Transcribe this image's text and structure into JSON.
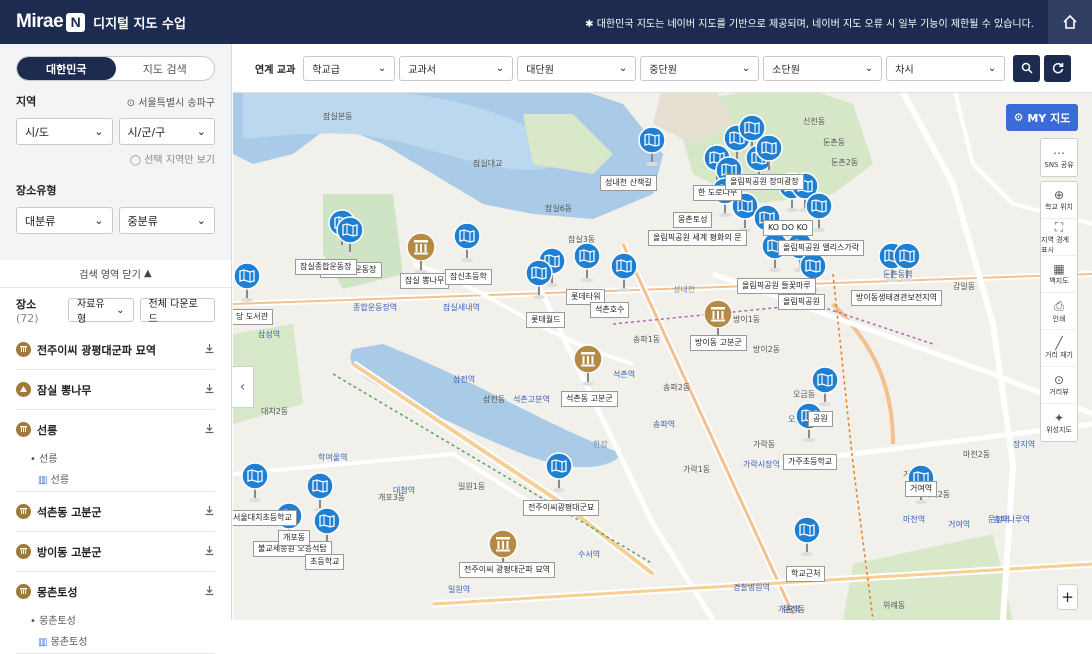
{
  "header": {
    "logo": "Mirae",
    "logo_n": "N",
    "app_title": "디지털 지도 수업",
    "notice": "✱ 대한민국 지도는 네이버 지도를 기반으로 제공되며, 네이버 지도 오류 시 일부 기능이 제한될 수 있습니다."
  },
  "sidebar": {
    "tabs": [
      "대한민국",
      "지도 검색"
    ],
    "region_label": "지역",
    "location": "서울특별시 송파구",
    "sido": "시/도",
    "sigungu": "시/군/구",
    "only_selected": "선택 지역만 보기",
    "place_type_label": "장소유형",
    "major": "대분류",
    "middle": "중분류",
    "collapse": "검색 영역 닫기",
    "list_title": "장소",
    "list_count": "(72)",
    "filter_btn": "자료유형",
    "download_all": "전체 다운로드",
    "items": [
      {
        "name": "전주이씨 광평대군파 묘역",
        "icon": "building"
      },
      {
        "name": "잠실 뽕나무",
        "icon": "tree"
      },
      {
        "name": "선릉",
        "icon": "building",
        "subs": [
          "선릉"
        ],
        "subsubs": [
          "선릉"
        ]
      },
      {
        "name": "석촌동 고분군",
        "icon": "building"
      },
      {
        "name": "방이동 고분군",
        "icon": "building"
      },
      {
        "name": "몽촌토성",
        "icon": "building",
        "subs": [
          "몽촌토성"
        ],
        "subsubs": [
          "몽촌토성"
        ]
      }
    ]
  },
  "toolbar": {
    "label": "연계 교과",
    "selects": [
      "학교급",
      "교과서",
      "대단원",
      "중단원",
      "소단원",
      "차시"
    ]
  },
  "map": {
    "mymap": "MY 지도",
    "tools": [
      [
        "SNS 공유",
        "share-icon"
      ],
      [
        "학교 위치",
        "target-icon"
      ],
      [
        "지역 경계 표시",
        "border-icon"
      ],
      [
        "백지도",
        "blankmap-icon"
      ],
      [
        "인쇄",
        "print-icon"
      ],
      [
        "거리 재기",
        "ruler-icon"
      ],
      [
        "거리뷰",
        "streetview-icon"
      ],
      [
        "위성지도",
        "satellite-icon"
      ]
    ],
    "zoom_in": "+",
    "pin_labels": [
      {
        "text": "성내천 산책길"
      },
      {
        "text": "잠실종합운동장"
      },
      {
        "text": "잠실 뽕나무"
      },
      {
        "text": "잠신초등학"
      },
      {
        "text": "롯데타워"
      },
      {
        "text": "석촌호수"
      },
      {
        "text": "롯데월드"
      },
      {
        "text": "방이동 고분군"
      },
      {
        "text": "석촌동 고분군"
      },
      {
        "text": "올림픽공원 들꽃마루"
      },
      {
        "text": "올림픽공원"
      },
      {
        "text": "방이동생태경관보전지역"
      },
      {
        "text": "가주초등학교"
      },
      {
        "text": "거여역"
      },
      {
        "text": "전주이씨광평대군묘"
      },
      {
        "text": "전주이씨 광평대군파 묘역"
      },
      {
        "text": "불교세종원 오층석탑"
      },
      {
        "text": "학교근처"
      },
      {
        "text": "당 도서관"
      },
      {
        "text": "올림픽공원 세계 평화의 문"
      },
      {
        "text": "잠실종합운동장"
      },
      {
        "text": "몽촌토성"
      },
      {
        "text": "초등학교"
      },
      {
        "text": "개포동"
      },
      {
        "text": "서울대치초등학교"
      },
      {
        "text": "한 도로나무"
      },
      {
        "text": "올림픽공원 장미광장"
      },
      {
        "text": "KO DO KO"
      },
      {
        "text": "올림픽공원 엘리스가락"
      },
      {
        "text": "공원"
      }
    ],
    "labels": [
      {
        "t": "잠실대교"
      },
      {
        "t": "잠실6동"
      },
      {
        "t": "잠실3동"
      },
      {
        "t": "잠실새내역"
      },
      {
        "t": "종합운동장역"
      },
      {
        "t": "삼성역"
      },
      {
        "t": "삼전역"
      },
      {
        "t": "삼전동"
      },
      {
        "t": "석촌역"
      },
      {
        "t": "석촌고분역"
      },
      {
        "t": "송파1동"
      },
      {
        "t": "송파2동"
      },
      {
        "t": "송파역"
      },
      {
        "t": "방이1동"
      },
      {
        "t": "방이2동"
      },
      {
        "t": "가락1동"
      },
      {
        "t": "가락동"
      },
      {
        "t": "문정동"
      },
      {
        "t": "마천2동"
      },
      {
        "t": "거여1동"
      },
      {
        "t": "거여2동"
      },
      {
        "t": "오금역"
      },
      {
        "t": "오금동"
      },
      {
        "t": "둔촌동"
      },
      {
        "t": "둔촌2동"
      },
      {
        "t": "둔촌동역"
      },
      {
        "t": "감일동"
      },
      {
        "t": "일원1동"
      },
      {
        "t": "대치2동"
      },
      {
        "t": "개포3동"
      },
      {
        "t": "대청역"
      },
      {
        "t": "학여울역"
      },
      {
        "t": "수서역"
      },
      {
        "t": "일원역"
      },
      {
        "t": "위례동"
      },
      {
        "t": "잠실본동"
      },
      {
        "t": "신천동"
      },
      {
        "t": "풍납동"
      },
      {
        "t": "한강"
      },
      {
        "t": "가락시장역"
      },
      {
        "t": "경찰병원역"
      },
      {
        "t": "개롱역"
      },
      {
        "t": "마천역"
      },
      {
        "t": "거여역"
      },
      {
        "t": "문정역"
      },
      {
        "t": "장지역"
      },
      {
        "t": "송파나루역"
      },
      {
        "t": "성내천"
      }
    ]
  }
}
